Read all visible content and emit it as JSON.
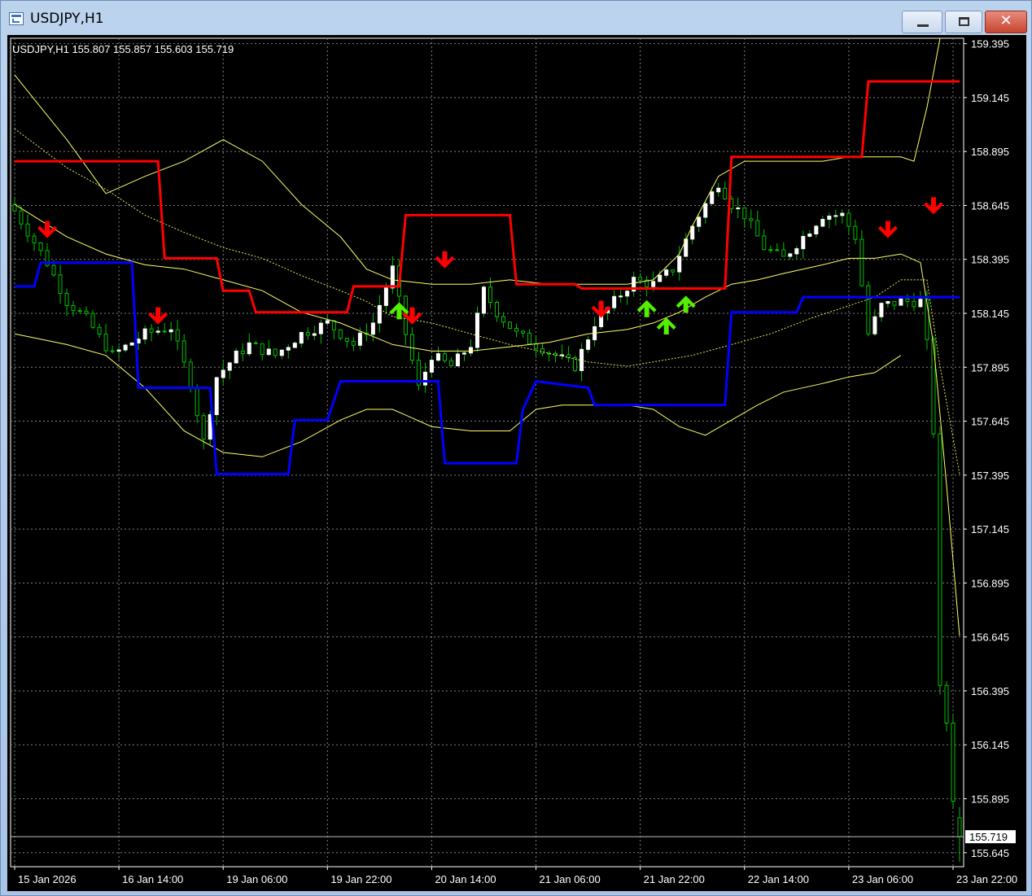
{
  "window": {
    "title": "USDJPY,H1",
    "close_glyph": "✕"
  },
  "header": {
    "text": "USDJPY,H1  155.807 155.857 155.603 155.719"
  },
  "chart_data": {
    "type": "candlestick",
    "symbol": "USDJPY",
    "timeframe": "H1",
    "ohlc": {
      "open": 155.807,
      "high": 155.857,
      "low": 155.603,
      "close": 155.719
    },
    "last_price": 155.719,
    "ylim": [
      155.58,
      159.42
    ],
    "y_ticks": [
      159.395,
      159.145,
      158.895,
      158.645,
      158.395,
      158.145,
      157.895,
      157.645,
      157.395,
      157.145,
      156.895,
      156.645,
      156.395,
      156.145,
      155.895,
      155.645
    ],
    "x_ticks": [
      "15 Jan 2026",
      "16 Jan 14:00",
      "19 Jan 06:00",
      "19 Jan 22:00",
      "20 Jan 14:00",
      "21 Jan 06:00",
      "21 Jan 22:00",
      "22 Jan 14:00",
      "23 Jan 06:00",
      "23 Jan 22:00"
    ],
    "x_tick_index": [
      0,
      16,
      32,
      48,
      64,
      80,
      96,
      112,
      128,
      144
    ],
    "bar_count": 146,
    "grid": true,
    "colors": {
      "background": "#000000",
      "bull_candle": "#ffffff",
      "bear_candle": "#000000",
      "wick": "#00c000",
      "grid": "#7f7f7f",
      "axis_text": "#ffffff",
      "band": "#ffff66",
      "resistance": "#ff0000",
      "support": "#0000ff",
      "sell_arrow": "#ff0000",
      "buy_arrow": "#55ee00"
    },
    "close_path": [
      [
        0,
        158.62
      ],
      [
        5,
        158.38
      ],
      [
        8,
        158.2
      ],
      [
        11,
        158.12
      ],
      [
        15,
        157.95
      ],
      [
        20,
        158.05
      ],
      [
        24,
        158.08
      ],
      [
        27,
        157.82
      ],
      [
        29,
        157.55
      ],
      [
        31,
        157.85
      ],
      [
        34,
        157.95
      ],
      [
        36,
        158.0
      ],
      [
        40,
        157.95
      ],
      [
        44,
        158.05
      ],
      [
        48,
        158.1
      ],
      [
        52,
        158.0
      ],
      [
        55,
        158.1
      ],
      [
        58,
        158.35
      ],
      [
        60,
        158.05
      ],
      [
        62,
        157.8
      ],
      [
        64,
        157.95
      ],
      [
        67,
        157.9
      ],
      [
        70,
        158.0
      ],
      [
        72,
        158.25
      ],
      [
        74,
        158.15
      ],
      [
        77,
        158.05
      ],
      [
        80,
        158.0
      ],
      [
        83,
        157.95
      ],
      [
        86,
        157.9
      ],
      [
        89,
        158.1
      ],
      [
        92,
        158.2
      ],
      [
        95,
        158.3
      ],
      [
        98,
        158.28
      ],
      [
        101,
        158.35
      ],
      [
        104,
        158.55
      ],
      [
        108,
        158.75
      ],
      [
        110,
        158.65
      ],
      [
        112,
        158.6
      ],
      [
        115,
        158.45
      ],
      [
        118,
        158.4
      ],
      [
        121,
        158.5
      ],
      [
        124,
        158.6
      ],
      [
        127,
        158.6
      ],
      [
        129,
        158.5
      ],
      [
        131,
        158.05
      ],
      [
        133,
        158.18
      ],
      [
        136,
        158.2
      ],
      [
        139,
        158.2
      ],
      [
        140,
        158.0
      ],
      [
        141,
        157.6
      ],
      [
        142,
        156.4
      ],
      [
        143,
        156.25
      ],
      [
        144,
        155.9
      ],
      [
        145,
        155.72
      ]
    ],
    "resistance": [
      [
        0,
        158.85
      ],
      [
        22,
        158.85
      ],
      [
        23,
        158.4
      ],
      [
        31,
        158.4
      ],
      [
        32,
        158.25
      ],
      [
        36,
        158.25
      ],
      [
        37,
        158.15
      ],
      [
        51,
        158.15
      ],
      [
        52,
        158.27
      ],
      [
        59,
        158.27
      ],
      [
        60,
        158.6
      ],
      [
        76,
        158.6
      ],
      [
        77,
        158.28
      ],
      [
        86,
        158.28
      ],
      [
        87,
        158.26
      ],
      [
        109,
        158.26
      ],
      [
        110,
        158.87
      ],
      [
        130,
        158.87
      ],
      [
        131,
        159.22
      ],
      [
        145,
        159.22
      ]
    ],
    "support": [
      [
        0,
        158.27
      ],
      [
        3,
        158.27
      ],
      [
        4,
        158.38
      ],
      [
        18,
        158.38
      ],
      [
        19,
        157.8
      ],
      [
        30,
        157.8
      ],
      [
        31,
        157.4
      ],
      [
        42,
        157.4
      ],
      [
        43,
        157.65
      ],
      [
        48,
        157.65
      ],
      [
        50,
        157.83
      ],
      [
        65,
        157.83
      ],
      [
        66,
        157.45
      ],
      [
        77,
        157.45
      ],
      [
        78,
        157.7
      ],
      [
        80,
        157.83
      ],
      [
        88,
        157.8
      ],
      [
        89,
        157.72
      ],
      [
        109,
        157.72
      ],
      [
        110,
        158.15
      ],
      [
        120,
        158.15
      ],
      [
        121,
        158.22
      ],
      [
        145,
        158.22
      ]
    ],
    "band_upper": [
      [
        0,
        159.25
      ],
      [
        8,
        158.95
      ],
      [
        14,
        158.7
      ],
      [
        20,
        158.78
      ],
      [
        26,
        158.85
      ],
      [
        32,
        158.95
      ],
      [
        38,
        158.85
      ],
      [
        44,
        158.65
      ],
      [
        50,
        158.5
      ],
      [
        54,
        158.35
      ],
      [
        58,
        158.3
      ],
      [
        64,
        158.28
      ],
      [
        70,
        158.28
      ],
      [
        76,
        158.3
      ],
      [
        82,
        158.28
      ],
      [
        88,
        158.28
      ],
      [
        94,
        158.28
      ],
      [
        98,
        158.3
      ],
      [
        102,
        158.42
      ],
      [
        104,
        158.55
      ],
      [
        108,
        158.78
      ],
      [
        112,
        158.85
      ],
      [
        118,
        158.85
      ],
      [
        124,
        158.85
      ],
      [
        128,
        158.87
      ],
      [
        132,
        158.87
      ],
      [
        136,
        158.87
      ],
      [
        138,
        158.85
      ],
      [
        140,
        159.1
      ],
      [
        142,
        159.42
      ]
    ],
    "band_mid": [
      [
        0,
        158.65
      ],
      [
        8,
        158.5
      ],
      [
        14,
        158.42
      ],
      [
        20,
        158.37
      ],
      [
        26,
        158.35
      ],
      [
        32,
        158.3
      ],
      [
        38,
        158.25
      ],
      [
        44,
        158.15
      ],
      [
        50,
        158.1
      ],
      [
        54,
        158.05
      ],
      [
        58,
        158.0
      ],
      [
        64,
        157.97
      ],
      [
        70,
        157.97
      ],
      [
        76,
        157.99
      ],
      [
        82,
        158.01
      ],
      [
        88,
        158.05
      ],
      [
        94,
        158.07
      ],
      [
        98,
        158.1
      ],
      [
        102,
        158.15
      ],
      [
        106,
        158.22
      ],
      [
        110,
        158.28
      ],
      [
        114,
        158.3
      ],
      [
        118,
        158.33
      ],
      [
        124,
        158.37
      ],
      [
        128,
        158.4
      ],
      [
        132,
        158.4
      ],
      [
        136,
        158.42
      ],
      [
        139,
        158.38
      ],
      [
        141,
        158.0
      ],
      [
        143,
        157.35
      ],
      [
        145,
        156.65
      ]
    ],
    "band_lower": [
      [
        0,
        158.05
      ],
      [
        8,
        158.0
      ],
      [
        14,
        157.95
      ],
      [
        20,
        157.8
      ],
      [
        26,
        157.6
      ],
      [
        32,
        157.5
      ],
      [
        38,
        157.48
      ],
      [
        44,
        157.55
      ],
      [
        50,
        157.65
      ],
      [
        54,
        157.7
      ],
      [
        58,
        157.7
      ],
      [
        64,
        157.62
      ],
      [
        70,
        157.6
      ],
      [
        76,
        157.6
      ],
      [
        80,
        157.7
      ],
      [
        84,
        157.72
      ],
      [
        88,
        157.72
      ],
      [
        94,
        157.72
      ],
      [
        98,
        157.7
      ],
      [
        102,
        157.62
      ],
      [
        106,
        157.58
      ],
      [
        110,
        157.65
      ],
      [
        114,
        157.72
      ],
      [
        118,
        157.78
      ],
      [
        124,
        157.82
      ],
      [
        128,
        157.85
      ],
      [
        132,
        157.87
      ],
      [
        136,
        157.95
      ]
    ],
    "ma_dotted": [
      [
        0,
        159.0
      ],
      [
        8,
        158.82
      ],
      [
        14,
        158.72
      ],
      [
        20,
        158.6
      ],
      [
        26,
        158.52
      ],
      [
        32,
        158.45
      ],
      [
        38,
        158.4
      ],
      [
        44,
        158.32
      ],
      [
        50,
        158.25
      ],
      [
        54,
        158.2
      ],
      [
        58,
        158.13
      ],
      [
        64,
        158.1
      ],
      [
        70,
        158.05
      ],
      [
        76,
        158.0
      ],
      [
        82,
        157.96
      ],
      [
        88,
        157.92
      ],
      [
        94,
        157.9
      ],
      [
        98,
        157.92
      ],
      [
        104,
        157.95
      ],
      [
        110,
        158.0
      ],
      [
        116,
        158.05
      ],
      [
        122,
        158.12
      ],
      [
        128,
        158.18
      ],
      [
        132,
        158.22
      ],
      [
        136,
        158.3
      ],
      [
        140,
        158.3
      ],
      [
        142,
        157.9
      ],
      [
        145,
        157.4
      ]
    ],
    "arrows": [
      {
        "i": 5,
        "price": 158.52,
        "dir": "down"
      },
      {
        "i": 22,
        "price": 158.12,
        "dir": "down"
      },
      {
        "i": 59,
        "price": 158.17,
        "dir": "up"
      },
      {
        "i": 61,
        "price": 158.12,
        "dir": "down"
      },
      {
        "i": 66,
        "price": 158.38,
        "dir": "down"
      },
      {
        "i": 90,
        "price": 158.15,
        "dir": "down"
      },
      {
        "i": 97,
        "price": 158.18,
        "dir": "up"
      },
      {
        "i": 100,
        "price": 158.1,
        "dir": "up"
      },
      {
        "i": 103,
        "price": 158.2,
        "dir": "up"
      },
      {
        "i": 134,
        "price": 158.52,
        "dir": "down"
      },
      {
        "i": 141,
        "price": 158.63,
        "dir": "down"
      }
    ]
  }
}
